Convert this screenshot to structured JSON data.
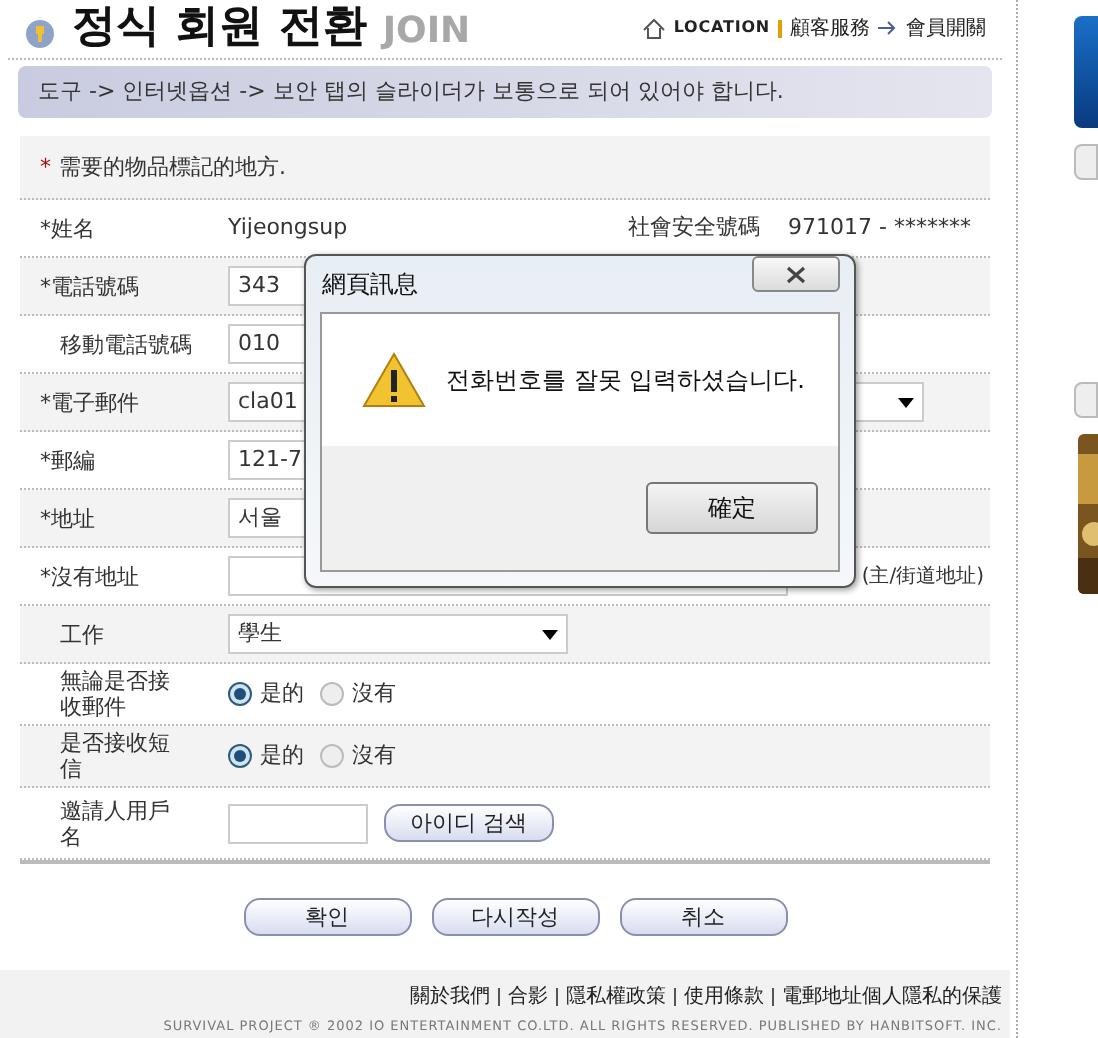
{
  "header": {
    "title": "정식 회원 전환",
    "title_en": "JOIN",
    "location_label": "LOCATION",
    "breadcrumbs": [
      "顧客服務",
      "會員開關"
    ]
  },
  "notice": "도구 -> 인터넷옵션 -> 보안 탭의 슬라이더가 보통으로 되어 있어야 합니다.",
  "form": {
    "note_mark": "*",
    "note": "需要的物品標記的地方.",
    "rows": [
      {
        "kind": "text",
        "label": "*姓名",
        "value": "Yijeongsup",
        "extra_label": "社會安全號碼",
        "extra_value": "971017 - *******"
      },
      {
        "kind": "input",
        "label": "*電話號碼",
        "value": "343"
      },
      {
        "kind": "input",
        "label": "移動電話號碼",
        "value": "010"
      },
      {
        "kind": "email",
        "label": "*電子郵件",
        "value": "cla01"
      },
      {
        "kind": "input",
        "label": "*郵編",
        "value": "121-7"
      },
      {
        "kind": "input",
        "label": "*地址",
        "value": "서울"
      },
      {
        "kind": "address",
        "label": "*沒有地址",
        "note": "(主/街道地址)"
      },
      {
        "kind": "select",
        "label": "工作",
        "value": "學生"
      },
      {
        "kind": "radio",
        "label": "無論是否接收郵件",
        "options": [
          {
            "label": "是的",
            "selected": true
          },
          {
            "label": "沒有",
            "selected": false
          }
        ]
      },
      {
        "kind": "radio",
        "label": "是否接收短信",
        "options": [
          {
            "label": "是的",
            "selected": true
          },
          {
            "label": "沒有",
            "selected": false
          }
        ]
      },
      {
        "kind": "search",
        "label": "邀請人用戶名",
        "button": "아이디 검색"
      }
    ]
  },
  "buttons": [
    "확인",
    "다시작성",
    "취소"
  ],
  "footer": {
    "links": [
      "關於我們",
      "合影",
      "隱私權政策",
      "使用條款",
      "電郵地址個人隱私的保護"
    ],
    "copyright": "SURVIVAL PROJECT ® 2002 IO ENTERTAINMENT CO.LTD. ALL RIGHTS RESERVED. PUBLISHED BY HANBITSOFT. INC."
  },
  "dialog": {
    "title": "網頁訊息",
    "message": "전화번호를 잘못 입력하셨습니다.",
    "button": "確定"
  }
}
